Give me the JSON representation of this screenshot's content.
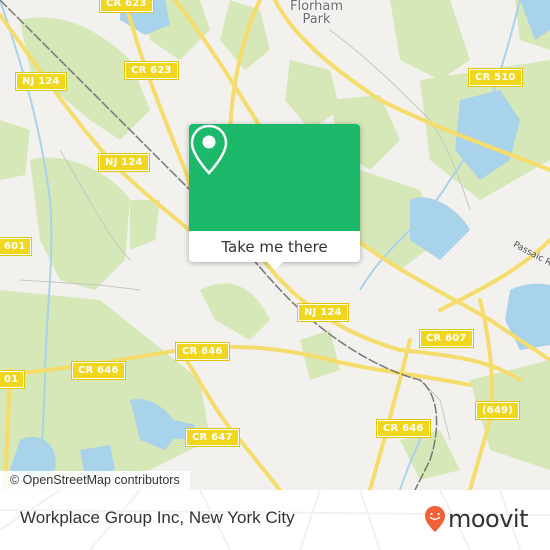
{
  "map": {
    "place_labels": [
      {
        "name": "Florham Park",
        "line1": "Florham",
        "line2": "Park"
      }
    ],
    "road_shields": [
      {
        "label": "CR 623",
        "id": "cr623-top"
      },
      {
        "label": "NJ 124",
        "id": "nj124-upper"
      },
      {
        "label": "CR 623",
        "id": "cr623"
      },
      {
        "label": "CR 510",
        "id": "cr510"
      },
      {
        "label": "NJ 124",
        "id": "nj124-middle"
      },
      {
        "label": "601",
        "id": "r601"
      },
      {
        "label": "NJ 124",
        "id": "nj124-lower"
      },
      {
        "label": "CR 607",
        "id": "cr607"
      },
      {
        "label": "CR 646",
        "id": "cr646-upper"
      },
      {
        "label": "CR 646",
        "id": "cr646-left"
      },
      {
        "label": "01",
        "id": "r601-lower"
      },
      {
        "label": "(649)",
        "id": "r649"
      },
      {
        "label": "CR 647",
        "id": "cr647"
      },
      {
        "label": "CR 646",
        "id": "cr646-lower"
      }
    ],
    "water_labels": [
      {
        "label": "Passaic R"
      }
    ],
    "attribution": "© OpenStreetMap contributors",
    "colors": {
      "land": "#f2f1ee",
      "park": "#d6e8b8",
      "water": "#a9d3ea",
      "major_road": "#f5dc6b",
      "rail": "#777777"
    }
  },
  "popup": {
    "icon": "location-pin-icon",
    "button_label": "Take me there",
    "color": "#1db96b"
  },
  "footer": {
    "title": "Workplace Group Inc, New York City",
    "brand": "moovit",
    "brand_color": "#f0613a"
  }
}
